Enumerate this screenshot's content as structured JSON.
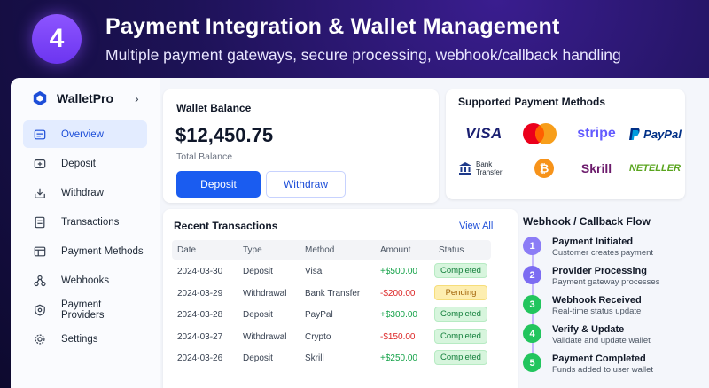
{
  "header": {
    "step_number": "4",
    "title": "Payment Integration & Wallet Management",
    "subtitle": "Multiple payment gateways, secure processing, webhook/callback handling"
  },
  "sidebar": {
    "brand": "WalletPro",
    "items": [
      {
        "label": "Overview",
        "icon": "overview-icon",
        "active": true
      },
      {
        "label": "Deposit",
        "icon": "deposit-icon"
      },
      {
        "label": "Withdraw",
        "icon": "withdraw-icon"
      },
      {
        "label": "Transactions",
        "icon": "transactions-icon"
      },
      {
        "label": "Payment Methods",
        "icon": "payment-methods-icon"
      },
      {
        "label": "Webhooks",
        "icon": "webhooks-icon"
      },
      {
        "label": "Payment Providers",
        "icon": "payment-providers-icon"
      },
      {
        "label": "Settings",
        "icon": "settings-icon"
      }
    ]
  },
  "wallet": {
    "label": "Wallet Balance",
    "amount": "$12,450.75",
    "sub": "Total Balance",
    "deposit_label": "Deposit",
    "withdraw_label": "Withdraw"
  },
  "methods": {
    "title": "Supported Payment Methods",
    "visa": "VISA",
    "stripe": "stripe",
    "paypal": "PayPal",
    "bank_line1": "Bank",
    "bank_line2": "Transfer",
    "skrill": "Skrill",
    "neteller": "NETELLER"
  },
  "transactions": {
    "title": "Recent Transactions",
    "view_all": "View All",
    "headers": {
      "date": "Date",
      "type": "Type",
      "method": "Method",
      "amount": "Amount",
      "status": "Status"
    },
    "rows": [
      {
        "date": "2024-03-30",
        "type": "Deposit",
        "method": "Visa",
        "amount": "+$500.00",
        "status": "Completed"
      },
      {
        "date": "2024-03-29",
        "type": "Withdrawal",
        "method": "Bank Transfer",
        "amount": "-$200.00",
        "status": "Pending"
      },
      {
        "date": "2024-03-28",
        "type": "Deposit",
        "method": "PayPal",
        "amount": "+$300.00",
        "status": "Completed"
      },
      {
        "date": "2024-03-27",
        "type": "Withdrawal",
        "method": "Crypto",
        "amount": "-$150.00",
        "status": "Completed"
      },
      {
        "date": "2024-03-26",
        "type": "Deposit",
        "method": "Skrill",
        "amount": "+$250.00",
        "status": "Completed"
      }
    ]
  },
  "flow": {
    "title": "Webhook / Callback Flow",
    "steps": [
      {
        "num": "1",
        "title": "Payment Initiated",
        "desc": "Customer creates payment",
        "color": "#8b7cf6"
      },
      {
        "num": "2",
        "title": "Provider Processing",
        "desc": "Payment gateway processes",
        "color": "#7c6cf2"
      },
      {
        "num": "3",
        "title": "Webhook Received",
        "desc": "Real-time status update",
        "color": "#22c55e"
      },
      {
        "num": "4",
        "title": "Verify & Update",
        "desc": "Validate and update wallet",
        "color": "#22c55e"
      },
      {
        "num": "5",
        "title": "Payment Completed",
        "desc": "Funds added to user wallet",
        "color": "#22c55e"
      }
    ]
  },
  "colors": {
    "accent": "#1a5cf0",
    "positive": "#16a34a",
    "negative": "#dc2626"
  }
}
